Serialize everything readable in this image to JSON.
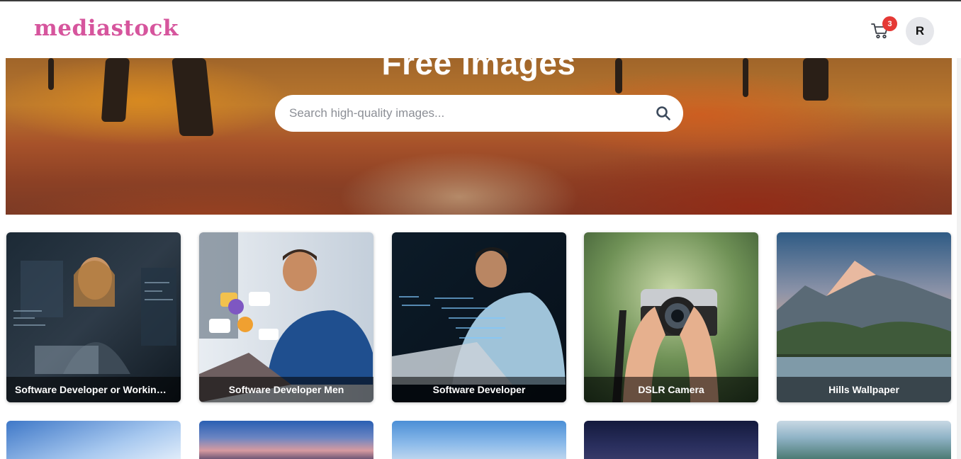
{
  "header": {
    "logo": "mediastock",
    "cart_count": "3",
    "avatar_initial": "R"
  },
  "hero": {
    "title": "Free Images",
    "search_placeholder": "Search high-quality images..."
  },
  "gallery": [
    {
      "title": "Software Developer or Working ..."
    },
    {
      "title": "Software Developer Men"
    },
    {
      "title": "Software Developer"
    },
    {
      "title": "DSLR Camera"
    },
    {
      "title": "Hills Wallpaper"
    }
  ],
  "colors": {
    "brand": "#d6559d",
    "badge": "#e53935"
  }
}
